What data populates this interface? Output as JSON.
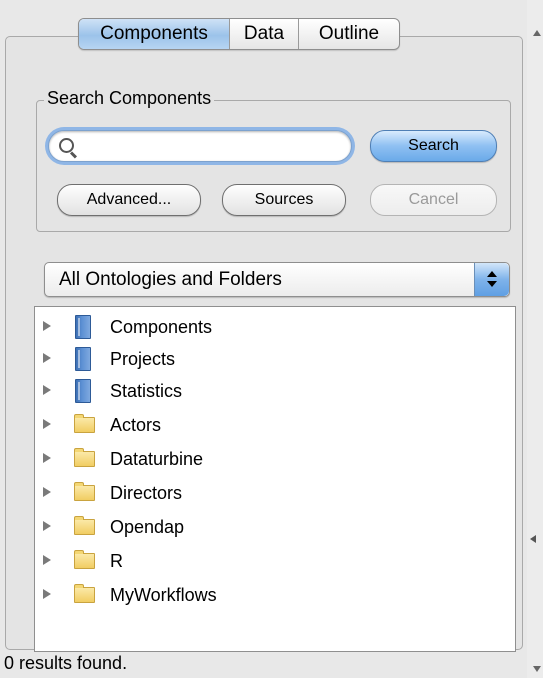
{
  "tabs": [
    {
      "label": "Components",
      "active": true
    },
    {
      "label": "Data",
      "active": false
    },
    {
      "label": "Outline",
      "active": false
    }
  ],
  "search": {
    "group_title": "Search Components",
    "value": "",
    "placeholder": "",
    "search_label": "Search",
    "advanced_label": "Advanced...",
    "sources_label": "Sources",
    "cancel_label": "Cancel"
  },
  "scope": {
    "selected": "All Ontologies and Folders"
  },
  "tree": {
    "items": [
      {
        "label": "Components",
        "icon": "book-icon"
      },
      {
        "label": "Projects",
        "icon": "book-icon"
      },
      {
        "label": "Statistics",
        "icon": "book-icon"
      },
      {
        "label": "Actors",
        "icon": "folder-icon"
      },
      {
        "label": "Dataturbine",
        "icon": "folder-icon"
      },
      {
        "label": "Directors",
        "icon": "folder-icon"
      },
      {
        "label": "Opendap",
        "icon": "folder-icon"
      },
      {
        "label": "R",
        "icon": "folder-icon"
      },
      {
        "label": "MyWorkflows",
        "icon": "folder-icon"
      }
    ]
  },
  "status": {
    "text": "0 results found."
  },
  "colors": {
    "accent": "#8fb6e6",
    "panel_bg": "#e8e8e8",
    "folder": "#f1cd63",
    "book": "#5b8fd3"
  }
}
